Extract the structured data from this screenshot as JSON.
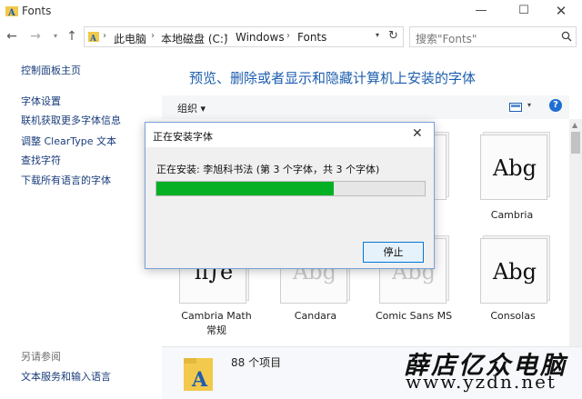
{
  "window": {
    "title": "Fonts",
    "minimize": "—",
    "maximize": "☐",
    "close": "✕"
  },
  "nav": {
    "back": "←",
    "forward": "→",
    "history": "▾",
    "up": "↑",
    "breadcrumbs": [
      "此电脑",
      "本地磁盘 (C:)",
      "Windows",
      "Fonts"
    ],
    "separator": "›",
    "dropdown": "▾",
    "refresh": "↻",
    "search_placeholder": "搜索\"Fonts\""
  },
  "sidebar": {
    "home": "控制面板主页",
    "links": [
      "字体设置",
      "联机获取更多字体信息",
      "调整 ClearType 文本",
      "查找字符",
      "下载所有语言的字体"
    ],
    "see_also_heading": "另请参阅",
    "see_also_links": [
      "文本服务和输入语言"
    ]
  },
  "main": {
    "title": "预览、删除或者显示和隐藏计算机上安装的字体",
    "organize": "组织 ▾",
    "view_dropdown": "▾",
    "help": "?"
  },
  "fonts": [
    {
      "name": "Cambria",
      "sub": "",
      "sample": "Abg"
    },
    {
      "name": "Cambria Math",
      "sub": "常规",
      "sample": "π∫e"
    },
    {
      "name": "Candara",
      "sub": "",
      "sample": "Abg"
    },
    {
      "name": "Comic Sans MS",
      "sub": "",
      "sample": "Abg"
    },
    {
      "name": "Consolas",
      "sub": "",
      "sample": "Abg"
    }
  ],
  "statusbar": {
    "count": "88 个项目"
  },
  "dialog": {
    "title": "正在安装字体",
    "close": "✕",
    "status": "正在安装: 李旭科书法 (第 3 个字体，共 3 个字体)",
    "progress_percent": 66,
    "stop_label": "停止"
  },
  "watermark": {
    "line1": "薛店亿众电脑",
    "line2": "www.yzdn.net"
  },
  "colors": {
    "progress_fill": "#06b025",
    "link": "#1a3c7a",
    "title_blue": "#1d5eaf",
    "dialog_border": "#7aa1d6"
  }
}
